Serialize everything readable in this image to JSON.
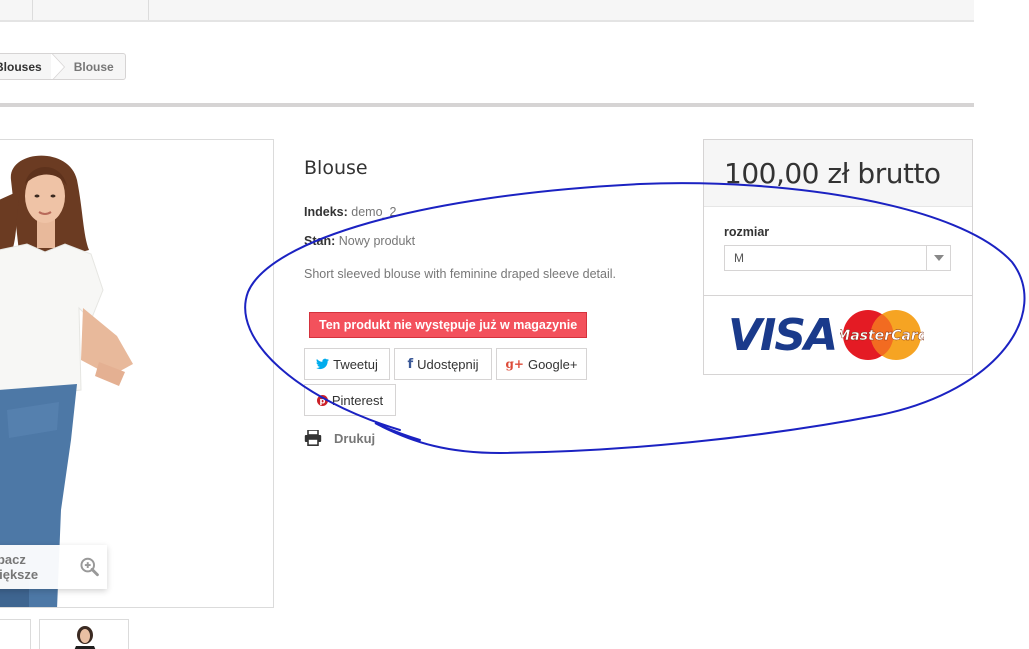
{
  "breadcrumb": {
    "items": [
      "Blouses",
      "Blouse"
    ]
  },
  "image": {
    "view_larger": "obacz większe"
  },
  "product": {
    "title": "Blouse",
    "reference_label": "Indeks:",
    "reference_value": "demo_2",
    "condition_label": "Stan:",
    "condition_value": "Nowy produkt",
    "description": "Short sleeved blouse with feminine draped sleeve detail.",
    "stock_status": "Ten produkt nie występuje już w magazynie"
  },
  "share": {
    "tweet": "Tweetuj",
    "facebook": "Udostępnij",
    "google": "Google+",
    "pinterest": "Pinterest",
    "print": "Drukuj"
  },
  "buy_box": {
    "price": "100,00 zł brutto",
    "attribute_label": "rozmiar",
    "size_selected": "M",
    "payment_visa": "VISA",
    "payment_mastercard": "MasterCard"
  },
  "colors": {
    "stock_badge": "#f3515c",
    "annotation": "#1b22c2",
    "twitter": "#00aced",
    "facebook": "#3b5998",
    "google": "#dd4b39",
    "pinterest": "#cb2027"
  }
}
